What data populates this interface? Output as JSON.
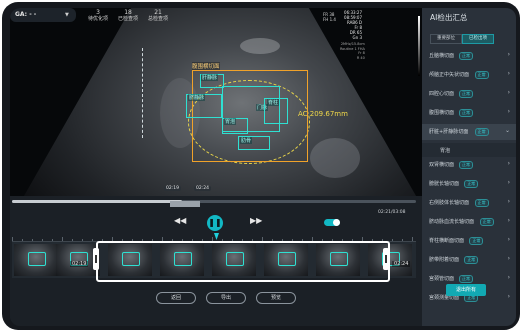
{
  "header": {
    "ga_label": "GA:",
    "ga_value": "- -",
    "stats": [
      {
        "value": "3",
        "label": "待优化项"
      },
      {
        "value": "18",
        "label": "已检查项"
      },
      {
        "value": "21",
        "label": "总检查项"
      }
    ]
  },
  "overlay": {
    "right_lines": [
      "Tis 1.4",
      "MI 0.9",
      "FR 30",
      "2MHz/15.8cm",
      "Routine 1 FHA",
      "Fr 8",
      "R 40"
    ],
    "left_lines": [
      "FR 38",
      "FH 1.4"
    ],
    "right_values": [
      "06:33:27",
      "08:59:07",
      "RAB6 D",
      "Fr 8",
      "DR 65",
      "Gn 3"
    ]
  },
  "annotations": {
    "main_label": "腹围横切面",
    "structures": [
      "肝静脉",
      "脐静脉",
      "门脉",
      "胃泡",
      "脊柱",
      "肋骨",
      "降主动脉"
    ],
    "measurement": "AC 209.67mm"
  },
  "playback": {
    "progress": 0.42,
    "clip_start": "02:19",
    "clip_end": "02:24",
    "current_total": "02:21/03:08",
    "play_icon": "pause-icon",
    "loop_enabled": true,
    "clips_start": "02:19",
    "clips_end": "02:24"
  },
  "actions": {
    "back": "返回",
    "export": "导出",
    "preview": "预览"
  },
  "sidebar": {
    "title": "AI检出汇总",
    "tabs": [
      "重要部位",
      "已检出项"
    ],
    "items": [
      {
        "label": "丘脑横切面",
        "badge": "正常"
      },
      {
        "label": "颅脑正中矢状切面",
        "badge": "正常"
      },
      {
        "label": "四腔心切面",
        "badge": "正常"
      },
      {
        "label": "腹围横切面",
        "badge": "正常"
      },
      {
        "label": "肝脏+肝静脉切面",
        "badge": "正常",
        "expanded": true
      },
      {
        "label": "胃泡",
        "badge": ""
      },
      {
        "label": "双肾横切面",
        "badge": "正常"
      },
      {
        "label": "膀胱长轴切面",
        "badge": "正常"
      },
      {
        "label": "右侧肢体长轴切面",
        "badge": "正常"
      },
      {
        "label": "脐动脉血流长轴切面",
        "badge": "正常"
      },
      {
        "label": "脊柱横断面切面",
        "badge": "正常"
      },
      {
        "label": "脐带附着切面",
        "badge": "正常"
      },
      {
        "label": "宫颈管切面",
        "badge": "正常"
      },
      {
        "label": "宫颈测量切面",
        "badge": "正常"
      }
    ],
    "export_button": "退出所有"
  },
  "colors": {
    "accent": "#12b8c4",
    "annotation": "#2fe0d2",
    "measure": "#f0d84a",
    "box": "#f0a22a"
  }
}
